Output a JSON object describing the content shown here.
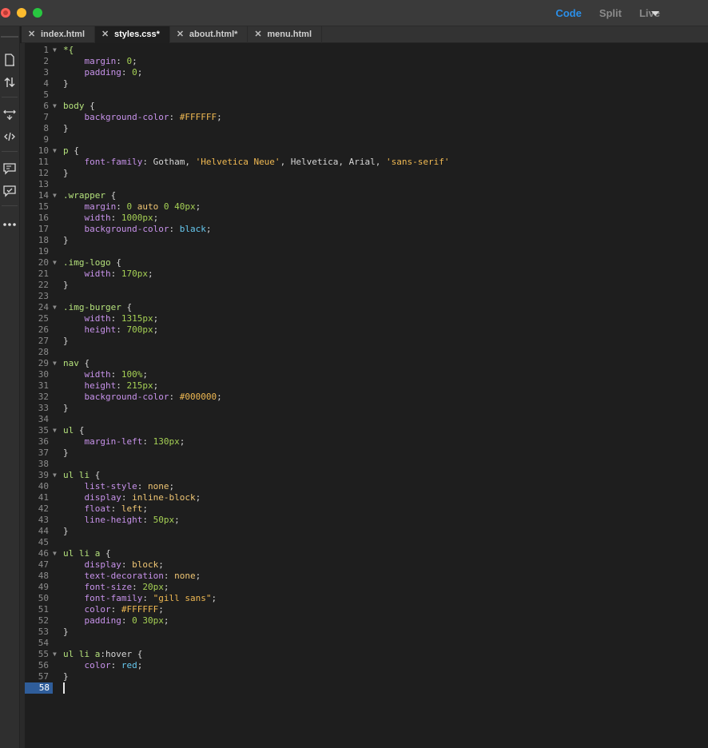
{
  "window": {
    "view_modes": [
      "Code",
      "Split",
      "Live"
    ],
    "active_view_mode": "Code"
  },
  "tabs": [
    {
      "label": "index.html",
      "active": false
    },
    {
      "label": "styles.css*",
      "active": true
    },
    {
      "label": "about.html*",
      "active": false
    },
    {
      "label": "menu.html",
      "active": false
    }
  ],
  "left_toolbar": {
    "icons": [
      "file-icon",
      "arrows-updown-icon",
      "expand-icon",
      "code-tag-icon",
      "comment-icon",
      "comment-check-icon",
      "more-icon"
    ]
  },
  "colors": {
    "accent": "#2b8fe8",
    "editor_bg": "#1e1e1e",
    "selector": "#b5e27c",
    "property": "#c792ea",
    "number": "#a6d155",
    "string": "#f0b952",
    "color_keyword": "#66c8ef",
    "current_line": "#2f5d9a"
  },
  "editor": {
    "current_line": 58,
    "lines": [
      {
        "n": 1,
        "fold": true,
        "t": [
          [
            "sel",
            "*{"
          ]
        ]
      },
      {
        "n": 2,
        "t": [
          [
            "pl",
            "    "
          ],
          [
            "prop",
            "margin"
          ],
          [
            "pl",
            ": "
          ],
          [
            "num",
            "0"
          ],
          [
            "pl",
            ";"
          ]
        ]
      },
      {
        "n": 3,
        "t": [
          [
            "pl",
            "    "
          ],
          [
            "prop",
            "padding"
          ],
          [
            "pl",
            ": "
          ],
          [
            "num",
            "0"
          ],
          [
            "pl",
            ";"
          ]
        ]
      },
      {
        "n": 4,
        "t": [
          [
            "pl",
            "}"
          ]
        ]
      },
      {
        "n": 5,
        "t": []
      },
      {
        "n": 6,
        "fold": true,
        "t": [
          [
            "sel",
            "body"
          ],
          [
            "pl",
            " {"
          ]
        ]
      },
      {
        "n": 7,
        "t": [
          [
            "pl",
            "    "
          ],
          [
            "prop",
            "background-color"
          ],
          [
            "pl",
            ": "
          ],
          [
            "hex",
            "#FFFFFF"
          ],
          [
            "pl",
            ";"
          ]
        ]
      },
      {
        "n": 8,
        "t": [
          [
            "pl",
            "}"
          ]
        ]
      },
      {
        "n": 9,
        "t": []
      },
      {
        "n": 10,
        "fold": true,
        "t": [
          [
            "sel",
            "p"
          ],
          [
            "pl",
            " {"
          ]
        ]
      },
      {
        "n": 11,
        "t": [
          [
            "pl",
            "    "
          ],
          [
            "prop",
            "font-family"
          ],
          [
            "pl",
            ": Gotham, "
          ],
          [
            "str",
            "'Helvetica Neue'"
          ],
          [
            "pl",
            ", Helvetica, Arial, "
          ],
          [
            "str",
            "'sans-serif'"
          ]
        ]
      },
      {
        "n": 12,
        "t": [
          [
            "pl",
            "}"
          ]
        ]
      },
      {
        "n": 13,
        "t": []
      },
      {
        "n": 14,
        "fold": true,
        "t": [
          [
            "sel",
            ".wrapper"
          ],
          [
            "pl",
            " {"
          ]
        ]
      },
      {
        "n": 15,
        "t": [
          [
            "pl",
            "    "
          ],
          [
            "prop",
            "margin"
          ],
          [
            "pl",
            ": "
          ],
          [
            "num",
            "0"
          ],
          [
            "pl",
            " "
          ],
          [
            "kw",
            "auto"
          ],
          [
            "pl",
            " "
          ],
          [
            "num",
            "0"
          ],
          [
            "pl",
            " "
          ],
          [
            "num",
            "40px"
          ],
          [
            "pl",
            ";"
          ]
        ]
      },
      {
        "n": 16,
        "t": [
          [
            "pl",
            "    "
          ],
          [
            "prop",
            "width"
          ],
          [
            "pl",
            ": "
          ],
          [
            "num",
            "1000px"
          ],
          [
            "pl",
            ";"
          ]
        ]
      },
      {
        "n": 17,
        "t": [
          [
            "pl",
            "    "
          ],
          [
            "prop",
            "background-color"
          ],
          [
            "pl",
            ": "
          ],
          [
            "col",
            "black"
          ],
          [
            "pl",
            ";"
          ]
        ]
      },
      {
        "n": 18,
        "t": [
          [
            "pl",
            "}"
          ]
        ]
      },
      {
        "n": 19,
        "t": []
      },
      {
        "n": 20,
        "fold": true,
        "t": [
          [
            "sel",
            ".img-logo"
          ],
          [
            "pl",
            " {"
          ]
        ]
      },
      {
        "n": 21,
        "t": [
          [
            "pl",
            "    "
          ],
          [
            "prop",
            "width"
          ],
          [
            "pl",
            ": "
          ],
          [
            "num",
            "170px"
          ],
          [
            "pl",
            ";"
          ]
        ]
      },
      {
        "n": 22,
        "t": [
          [
            "pl",
            "}"
          ]
        ]
      },
      {
        "n": 23,
        "t": []
      },
      {
        "n": 24,
        "fold": true,
        "t": [
          [
            "sel",
            ".img-burger"
          ],
          [
            "pl",
            " {"
          ]
        ]
      },
      {
        "n": 25,
        "t": [
          [
            "pl",
            "    "
          ],
          [
            "prop",
            "width"
          ],
          [
            "pl",
            ": "
          ],
          [
            "num",
            "1315px"
          ],
          [
            "pl",
            ";"
          ]
        ]
      },
      {
        "n": 26,
        "t": [
          [
            "pl",
            "    "
          ],
          [
            "prop",
            "height"
          ],
          [
            "pl",
            ": "
          ],
          [
            "num",
            "700px"
          ],
          [
            "pl",
            ";"
          ]
        ]
      },
      {
        "n": 27,
        "t": [
          [
            "pl",
            "}"
          ]
        ]
      },
      {
        "n": 28,
        "t": []
      },
      {
        "n": 29,
        "fold": true,
        "t": [
          [
            "sel",
            "nav"
          ],
          [
            "pl",
            " {"
          ]
        ]
      },
      {
        "n": 30,
        "t": [
          [
            "pl",
            "    "
          ],
          [
            "prop",
            "width"
          ],
          [
            "pl",
            ": "
          ],
          [
            "num",
            "100%"
          ],
          [
            "pl",
            ";"
          ]
        ]
      },
      {
        "n": 31,
        "t": [
          [
            "pl",
            "    "
          ],
          [
            "prop",
            "height"
          ],
          [
            "pl",
            ": "
          ],
          [
            "num",
            "215px"
          ],
          [
            "pl",
            ";"
          ]
        ]
      },
      {
        "n": 32,
        "t": [
          [
            "pl",
            "    "
          ],
          [
            "prop",
            "background-color"
          ],
          [
            "pl",
            ": "
          ],
          [
            "hex",
            "#000000"
          ],
          [
            "pl",
            ";"
          ]
        ]
      },
      {
        "n": 33,
        "t": [
          [
            "pl",
            "}"
          ]
        ]
      },
      {
        "n": 34,
        "t": []
      },
      {
        "n": 35,
        "fold": true,
        "t": [
          [
            "sel",
            "ul"
          ],
          [
            "pl",
            " {"
          ]
        ]
      },
      {
        "n": 36,
        "t": [
          [
            "pl",
            "    "
          ],
          [
            "prop",
            "margin-left"
          ],
          [
            "pl",
            ": "
          ],
          [
            "num",
            "130px"
          ],
          [
            "pl",
            ";"
          ]
        ]
      },
      {
        "n": 37,
        "t": [
          [
            "pl",
            "}"
          ]
        ]
      },
      {
        "n": 38,
        "t": []
      },
      {
        "n": 39,
        "fold": true,
        "t": [
          [
            "sel",
            "ul li"
          ],
          [
            "pl",
            " {"
          ]
        ]
      },
      {
        "n": 40,
        "t": [
          [
            "pl",
            "    "
          ],
          [
            "prop",
            "list-style"
          ],
          [
            "pl",
            ": "
          ],
          [
            "kw",
            "none"
          ],
          [
            "pl",
            ";"
          ]
        ]
      },
      {
        "n": 41,
        "t": [
          [
            "pl",
            "    "
          ],
          [
            "prop",
            "display"
          ],
          [
            "pl",
            ": "
          ],
          [
            "kw",
            "inline-block"
          ],
          [
            "pl",
            ";"
          ]
        ]
      },
      {
        "n": 42,
        "t": [
          [
            "pl",
            "    "
          ],
          [
            "prop",
            "float"
          ],
          [
            "pl",
            ": "
          ],
          [
            "kw",
            "left"
          ],
          [
            "pl",
            ";"
          ]
        ]
      },
      {
        "n": 43,
        "t": [
          [
            "pl",
            "    "
          ],
          [
            "prop",
            "line-height"
          ],
          [
            "pl",
            ": "
          ],
          [
            "num",
            "50px"
          ],
          [
            "pl",
            ";"
          ]
        ]
      },
      {
        "n": 44,
        "t": [
          [
            "pl",
            "}"
          ]
        ]
      },
      {
        "n": 45,
        "t": []
      },
      {
        "n": 46,
        "fold": true,
        "t": [
          [
            "sel",
            "ul li a"
          ],
          [
            "pl",
            " {"
          ]
        ]
      },
      {
        "n": 47,
        "t": [
          [
            "pl",
            "    "
          ],
          [
            "prop",
            "display"
          ],
          [
            "pl",
            ": "
          ],
          [
            "kw",
            "block"
          ],
          [
            "pl",
            ";"
          ]
        ]
      },
      {
        "n": 48,
        "t": [
          [
            "pl",
            "    "
          ],
          [
            "prop",
            "text-decoration"
          ],
          [
            "pl",
            ": "
          ],
          [
            "kw",
            "none"
          ],
          [
            "pl",
            ";"
          ]
        ]
      },
      {
        "n": 49,
        "t": [
          [
            "pl",
            "    "
          ],
          [
            "prop",
            "font-size"
          ],
          [
            "pl",
            ": "
          ],
          [
            "num",
            "20px"
          ],
          [
            "pl",
            ";"
          ]
        ]
      },
      {
        "n": 50,
        "t": [
          [
            "pl",
            "    "
          ],
          [
            "prop",
            "font-family"
          ],
          [
            "pl",
            ": "
          ],
          [
            "str",
            "\"gill sans\""
          ],
          [
            "pl",
            ";"
          ]
        ]
      },
      {
        "n": 51,
        "t": [
          [
            "pl",
            "    "
          ],
          [
            "prop",
            "color"
          ],
          [
            "pl",
            ": "
          ],
          [
            "hex",
            "#FFFFFF"
          ],
          [
            "pl",
            ";"
          ]
        ]
      },
      {
        "n": 52,
        "t": [
          [
            "pl",
            "    "
          ],
          [
            "prop",
            "padding"
          ],
          [
            "pl",
            ": "
          ],
          [
            "num",
            "0"
          ],
          [
            "pl",
            " "
          ],
          [
            "num",
            "30px"
          ],
          [
            "pl",
            ";"
          ]
        ]
      },
      {
        "n": 53,
        "t": [
          [
            "pl",
            "}"
          ]
        ]
      },
      {
        "n": 54,
        "t": []
      },
      {
        "n": 55,
        "fold": true,
        "t": [
          [
            "sel",
            "ul li a"
          ],
          [
            "pl",
            ":hover {"
          ]
        ]
      },
      {
        "n": 56,
        "t": [
          [
            "pl",
            "    "
          ],
          [
            "prop",
            "color"
          ],
          [
            "pl",
            ": "
          ],
          [
            "col",
            "red"
          ],
          [
            "pl",
            ";"
          ]
        ]
      },
      {
        "n": 57,
        "t": [
          [
            "pl",
            "}"
          ]
        ]
      },
      {
        "n": 58,
        "t": []
      }
    ]
  }
}
